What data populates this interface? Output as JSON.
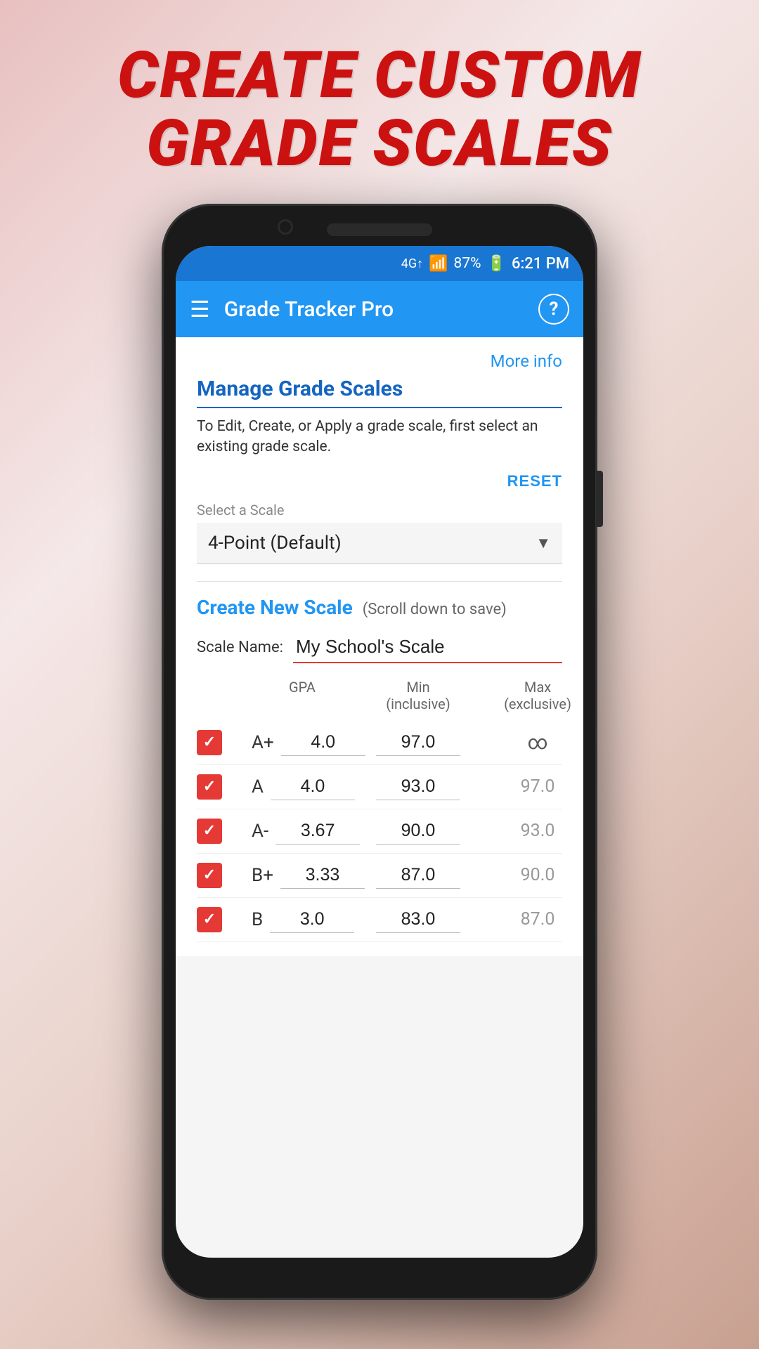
{
  "background": {
    "gradient": "linear-gradient(135deg, #e8c0c0 0%, #f5e8e8 30%, #e8d0c8 60%, #c8a090 100%)"
  },
  "hero": {
    "title_line1": "CREATE CUSTOM",
    "title_line2": "GRADE SCALES"
  },
  "status_bar": {
    "signal": "4G",
    "battery": "87%",
    "time": "6:21 PM"
  },
  "app_bar": {
    "title": "Grade Tracker Pro",
    "help_label": "?"
  },
  "content": {
    "more_info_label": "More info",
    "section_title": "Manage Grade Scales",
    "description": "To Edit, Create, or Apply a grade scale, first select an existing grade scale.",
    "reset_label": "RESET",
    "select_label": "Select a Scale",
    "selected_scale": "4-Point (Default)",
    "create_section_title": "Create New Scale",
    "create_section_hint": "(Scroll down to save)",
    "scale_name_label": "Scale Name:",
    "scale_name_value": "My School's Scale",
    "table_headers": {
      "col1": "",
      "col2": "GPA",
      "col3": "Min\n(inclusive)",
      "col4": "Max\n(exclusive)"
    },
    "grades": [
      {
        "label": "A+",
        "checked": true,
        "gpa": "4.0",
        "min": "97.0",
        "max": "∞"
      },
      {
        "label": "A",
        "checked": true,
        "gpa": "4.0",
        "min": "93.0",
        "max": "97.0"
      },
      {
        "label": "A-",
        "checked": true,
        "gpa": "3.67",
        "min": "90.0",
        "max": "93.0"
      },
      {
        "label": "B+",
        "checked": true,
        "gpa": "3.33",
        "min": "87.0",
        "max": "90.0"
      },
      {
        "label": "B",
        "checked": true,
        "gpa": "3.0",
        "min": "83.0",
        "max": "87.0"
      }
    ]
  },
  "colors": {
    "primary": "#2196f3",
    "accent": "#e53935",
    "title_color": "#cc1111"
  }
}
